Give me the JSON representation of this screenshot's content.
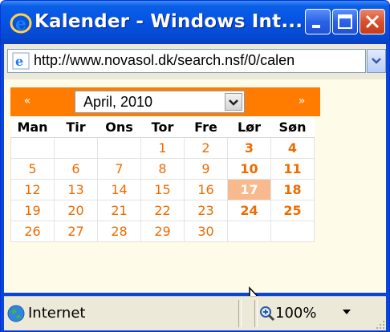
{
  "window": {
    "title": "Kalender - Windows Int...",
    "controls": {
      "minimize": "minimize",
      "maximize": "maximize",
      "close": "close"
    }
  },
  "address": {
    "url": "http://www.novasol.dk/search.nsf/0/calen"
  },
  "calendar": {
    "prev_label": "«",
    "next_label": "»",
    "month_selected": "April, 2010",
    "weekdays": [
      "Man",
      "Tir",
      "Ons",
      "Tor",
      "Fre",
      "Lør",
      "Søn"
    ],
    "weeks": [
      [
        "",
        "",
        "",
        "1",
        "2",
        "3",
        "4"
      ],
      [
        "5",
        "6",
        "7",
        "8",
        "9",
        "10",
        "11"
      ],
      [
        "12",
        "13",
        "14",
        "15",
        "16",
        "17",
        "18"
      ],
      [
        "19",
        "20",
        "21",
        "22",
        "23",
        "24",
        "25"
      ],
      [
        "26",
        "27",
        "28",
        "29",
        "30",
        "",
        ""
      ]
    ],
    "highlighted_day": "17",
    "colors": {
      "accent": "#ff7c00",
      "day_text": "#ee6b00",
      "highlight": "#f7b98d",
      "background": "#fefbe8"
    }
  },
  "status": {
    "zone": "Internet",
    "zoom": "100%"
  }
}
